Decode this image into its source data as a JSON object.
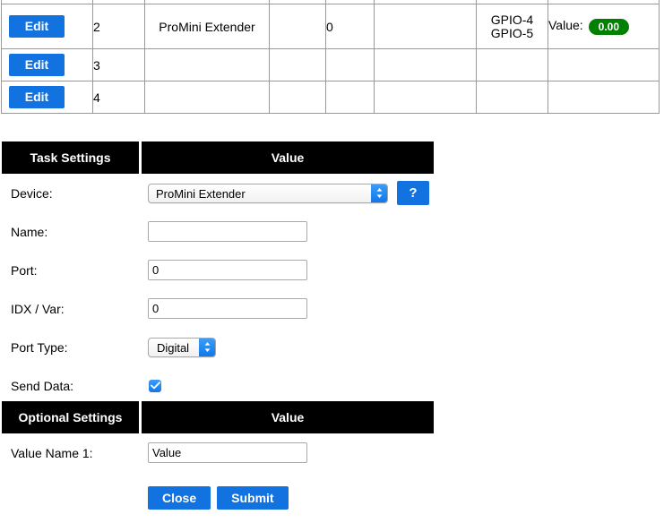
{
  "devices_table": {
    "columns": [
      "",
      "task",
      "device_name",
      "blank1",
      "port",
      "blank2",
      "gpio",
      "value"
    ],
    "rows": [
      {
        "edit_label": "Edit",
        "task": "2",
        "device_name": "ProMini Extender",
        "blank1": "",
        "port": "0",
        "blank2": "",
        "gpio": [
          "GPIO-4",
          "GPIO-5"
        ],
        "value_label": "Value:",
        "value": "0.00",
        "value_badge_color": "#008000"
      },
      {
        "edit_label": "Edit",
        "task": "3",
        "device_name": "",
        "blank1": "",
        "port": "",
        "blank2": "",
        "gpio": [],
        "value_label": "",
        "value": ""
      },
      {
        "edit_label": "Edit",
        "task": "4",
        "device_name": "",
        "blank1": "",
        "port": "",
        "blank2": "",
        "gpio": [],
        "value_label": "",
        "value": ""
      }
    ]
  },
  "task_settings": {
    "header_left": "Task Settings",
    "header_right": "Value",
    "device": {
      "label": "Device:",
      "value": "ProMini Extender",
      "help_label": "?"
    },
    "name": {
      "label": "Name:",
      "value": "",
      "placeholder": ""
    },
    "port": {
      "label": "Port:",
      "value": "0"
    },
    "idx_var": {
      "label": "IDX / Var:",
      "value": "0"
    },
    "port_type": {
      "label": "Port Type:",
      "value": "Digital"
    },
    "send_data": {
      "label": "Send Data:",
      "checked": "true"
    }
  },
  "optional_settings": {
    "header_left": "Optional Settings",
    "header_right": "Value",
    "value_name_1": {
      "label": "Value Name 1:",
      "value": "Value"
    }
  },
  "actions": {
    "close_label": "Close",
    "submit_label": "Submit"
  },
  "colors": {
    "button_blue": "#1272df",
    "badge_green": "#008000",
    "header_black": "#000000"
  }
}
